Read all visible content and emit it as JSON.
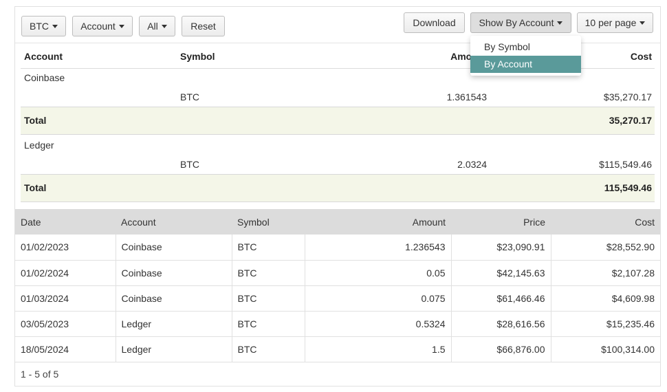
{
  "toolbar": {
    "symbol_filter": "BTC",
    "account_filter": "Account",
    "all_filter": "All",
    "reset": "Reset",
    "download": "Download",
    "group_by": "Show By Account",
    "page_size": "10 per page"
  },
  "group_menu": {
    "items": [
      "By Symbol",
      "By Account"
    ],
    "selected": "By Account"
  },
  "summary": {
    "headers": {
      "account": "Account",
      "symbol": "Symbol",
      "amount": "Amount",
      "cost": "Cost"
    },
    "groups": [
      {
        "account": "Coinbase",
        "symbol": "BTC",
        "amount": "1.361543",
        "cost": "$35,270.17",
        "total_label": "Total",
        "total": "35,270.17"
      },
      {
        "account": "Ledger",
        "symbol": "BTC",
        "amount": "2.0324",
        "cost": "$115,549.46",
        "total_label": "Total",
        "total": "115,549.46"
      }
    ]
  },
  "detail": {
    "headers": [
      "Date",
      "Account",
      "Symbol",
      "Amount",
      "Price",
      "Cost"
    ],
    "rows": [
      [
        "01/02/2023",
        "Coinbase",
        "BTC",
        "1.236543",
        "$23,090.91",
        "$28,552.90"
      ],
      [
        "01/02/2024",
        "Coinbase",
        "BTC",
        "0.05",
        "$42,145.63",
        "$2,107.28"
      ],
      [
        "01/03/2024",
        "Coinbase",
        "BTC",
        "0.075",
        "$61,466.46",
        "$4,609.98"
      ],
      [
        "03/05/2023",
        "Ledger",
        "BTC",
        "0.5324",
        "$28,616.56",
        "$15,235.46"
      ],
      [
        "18/05/2024",
        "Ledger",
        "BTC",
        "1.5",
        "$66,876.00",
        "$100,314.00"
      ]
    ]
  },
  "pager": {
    "text": "1 - 5 of 5"
  },
  "colors": {
    "menu_selected": "#5a9a9a",
    "total_row_bg": "#f4f6e8",
    "table_header_bg": "#dcdcdc"
  }
}
